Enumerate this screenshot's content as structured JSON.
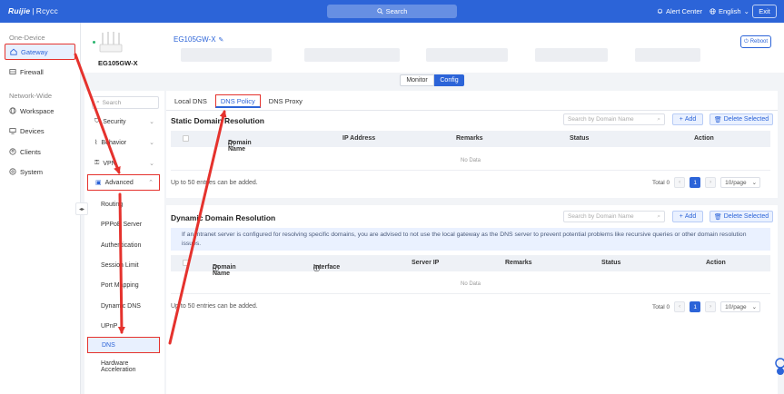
{
  "topbar": {
    "logo_brand": "Ruijie",
    "logo_sub": "Rcycc",
    "search_label": "Search",
    "alert_label": "Alert Center",
    "lang_label": "English",
    "exit_label": "Exit"
  },
  "sidebar": {
    "group1": "One-Device",
    "group2": "Network-Wide",
    "items": [
      {
        "label": "Gateway",
        "icon": "home-icon"
      },
      {
        "label": "Firewall",
        "icon": "firewall-icon"
      },
      {
        "label": "Workspace",
        "icon": "globe-icon"
      },
      {
        "label": "Devices",
        "icon": "devices-icon"
      },
      {
        "label": "Clients",
        "icon": "clients-icon"
      },
      {
        "label": "System",
        "icon": "system-icon"
      }
    ]
  },
  "device": {
    "model_label": "EG105GW-X",
    "name_link": "EG105GW-X",
    "reboot_label": "Reboot"
  },
  "mode_toggle": {
    "monitor": "Monitor",
    "config": "Config",
    "selected": "Config"
  },
  "submenu": {
    "search_placeholder": "Search",
    "items": [
      {
        "label": "Security"
      },
      {
        "label": "Behavior"
      },
      {
        "label": "VPN"
      },
      {
        "label": "Advanced"
      }
    ],
    "children": [
      {
        "label": "Routing"
      },
      {
        "label": "PPPoE Server"
      },
      {
        "label": "Authentication"
      },
      {
        "label": "Session Limit"
      },
      {
        "label": "Port Mapping"
      },
      {
        "label": "Dynamic DNS"
      },
      {
        "label": "UPnP"
      },
      {
        "label": "DNS"
      },
      {
        "label": "Hardware Acceleration"
      }
    ]
  },
  "tabs": [
    {
      "label": "Local DNS"
    },
    {
      "label": "DNS Policy"
    },
    {
      "label": "DNS Proxy"
    }
  ],
  "static_section": {
    "title": "Static Domain Resolution",
    "search_placeholder": "Search by Domain Name",
    "add_label": "Add",
    "delete_label": "Delete Selected",
    "columns": [
      "Domain Name",
      "IP Address",
      "Remarks",
      "Status",
      "Action"
    ],
    "no_data": "No Data",
    "hint": "Up to 50 entries can be added.",
    "total_label": "Total 0",
    "page": "1",
    "page_size": "10/page"
  },
  "dynamic_section": {
    "title": "Dynamic Domain Resolution",
    "search_placeholder": "Search by Domain Name",
    "add_label": "Add",
    "delete_label": "Delete Selected",
    "notice": "If an intranet server is configured for resolving specific domains, you are advised to not use the local gateway as the DNS server to prevent potential problems like recursive queries or other domain resolution issues.",
    "columns": [
      "Domain Name",
      "Interface",
      "Server IP",
      "Remarks",
      "Status",
      "Action"
    ],
    "no_data": "No Data",
    "hint": "Up to 50 entries can be added.",
    "total_label": "Total 0",
    "page": "1",
    "page_size": "10/page"
  },
  "colors": {
    "brand_blue": "#2c64d8",
    "annotation_red": "#e5322d"
  }
}
